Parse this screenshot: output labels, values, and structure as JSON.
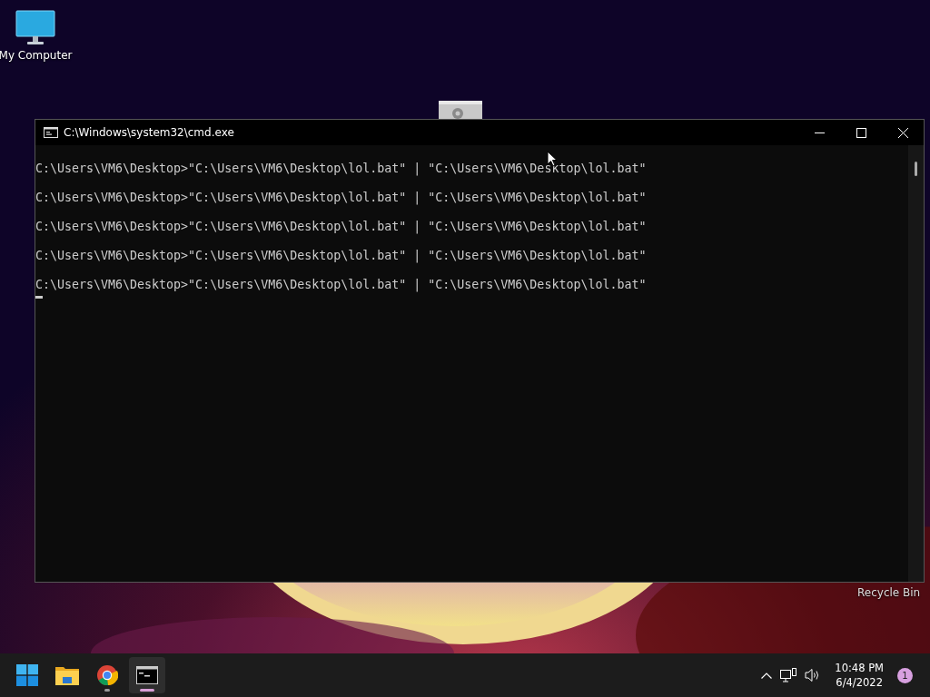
{
  "desktop": {
    "icons": [
      {
        "kind": "computer",
        "label": "My Computer"
      },
      {
        "kind": "recycle",
        "label": "Recycle Bin"
      }
    ]
  },
  "window": {
    "title": "C:\\Windows\\system32\\cmd.exe",
    "lines": [
      "C:\\Users\\VM6\\Desktop>\"C:\\Users\\VM6\\Desktop\\lol.bat\" | \"C:\\Users\\VM6\\Desktop\\lol.bat\"",
      "C:\\Users\\VM6\\Desktop>\"C:\\Users\\VM6\\Desktop\\lol.bat\" | \"C:\\Users\\VM6\\Desktop\\lol.bat\"",
      "C:\\Users\\VM6\\Desktop>\"C:\\Users\\VM6\\Desktop\\lol.bat\" | \"C:\\Users\\VM6\\Desktop\\lol.bat\"",
      "C:\\Users\\VM6\\Desktop>\"C:\\Users\\VM6\\Desktop\\lol.bat\" | \"C:\\Users\\VM6\\Desktop\\lol.bat\"",
      "C:\\Users\\VM6\\Desktop>\"C:\\Users\\VM6\\Desktop\\lol.bat\" | \"C:\\Users\\VM6\\Desktop\\lol.bat\""
    ]
  },
  "taskbar": {
    "apps": [
      {
        "kind": "start",
        "running": false,
        "selected": false
      },
      {
        "kind": "folder",
        "running": false,
        "selected": false
      },
      {
        "kind": "browser",
        "running": true,
        "selected": false
      },
      {
        "kind": "terminal",
        "running": true,
        "selected": true
      }
    ],
    "time": "10:48 PM",
    "date": "6/4/2022",
    "notifications": "1"
  }
}
